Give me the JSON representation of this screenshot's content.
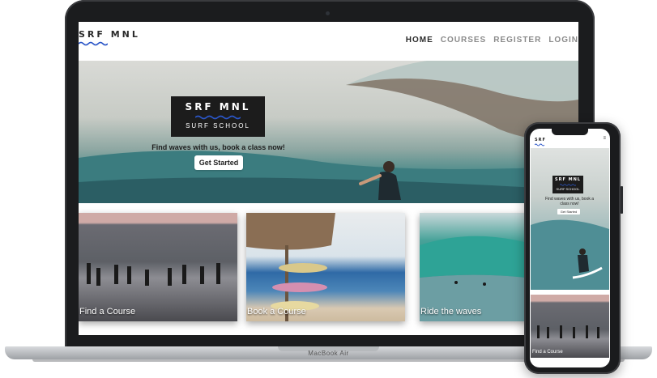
{
  "device_label": "MacBook Air",
  "site": {
    "logo": "SRF MNL",
    "nav": [
      {
        "label": "HOME",
        "active": true
      },
      {
        "label": "COURSES",
        "active": false
      },
      {
        "label": "REGISTER",
        "active": false
      },
      {
        "label": "LOGIN",
        "active": false
      }
    ],
    "hero": {
      "badge_title": "SRF MNL",
      "badge_subtitle": "SURF SCHOOL",
      "tagline": "Find waves with us, book a class now!",
      "cta": "Get Started"
    },
    "cards": [
      {
        "label": "Find a Course"
      },
      {
        "label": "Book a Course"
      },
      {
        "label": "Ride the waves"
      }
    ]
  },
  "phone": {
    "logo": "SRF",
    "menu_icon": "hamburger-icon",
    "badge_title": "SRF MNL",
    "badge_subtitle": "SURF SCHOOL",
    "tagline": "Find waves with us, book a class now!",
    "cta": "Get Started",
    "card_label": "Find a Course"
  },
  "colors": {
    "logo_wave": "#2b56c8",
    "badge_bg": "#1c1c1c",
    "nav_active": "#2a2a2a",
    "nav_inactive": "#8a8a8a"
  }
}
